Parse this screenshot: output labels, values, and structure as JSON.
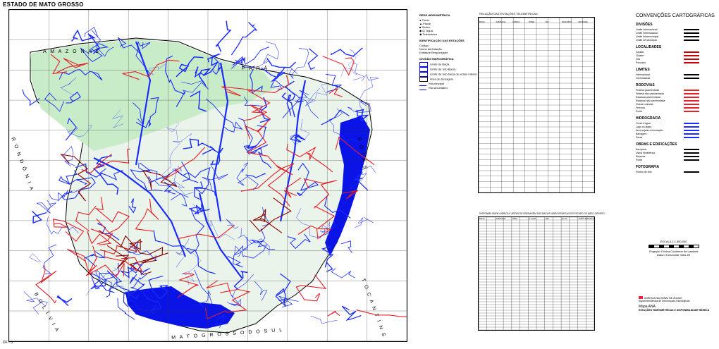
{
  "header": {
    "title": "ESTADO DE MATO GROSSO"
  },
  "sheet": {
    "code": "DF - 3"
  },
  "map": {
    "region_labels": [
      "A M A Z O N A S",
      "P A R Á",
      "M A T O   G R O S S O   D O   S U L",
      "R O N D Ô N I A",
      "B O L Í V I A",
      "G O I Á S",
      "T O C A N T I N S"
    ],
    "colors": {
      "river": "#1a2cff",
      "road": "#e8202a",
      "highway": "#8b0000",
      "swamp": "#0010e0",
      "forest_green": "#c9ecc8",
      "land": "#e9f4ea"
    },
    "longitudes": [
      "60°",
      "59°",
      "58°",
      "57°",
      "56°",
      "55°",
      "54°",
      "53°",
      "52°",
      "51°"
    ],
    "latitudes": [
      "8°",
      "9°",
      "10°",
      "11°",
      "12°",
      "13°",
      "14°",
      "15°",
      "16°",
      "17°",
      "18°"
    ]
  },
  "legend_left": {
    "heading": "REDE HIDROMÉTRICA",
    "items": [
      "Fluvio",
      "Pluvio",
      "Sedim.",
      "Q. Água",
      "Telemétrica"
    ],
    "identification_heading": "IDENTIFICAÇÃO DAS ESTAÇÕES",
    "identification_items": [
      "Código",
      "Nome da Estação",
      "Entidade Responsável"
    ],
    "basin_heading": "DIVISÃO HIDROGRÁFICA",
    "basin_items": [
      "Limite de Bacia",
      "Limite de Sub-Bacia",
      "Limite de Sub-bacia de ordem inferior",
      "Área de drenagem",
      "Rio principal",
      "Rio secundário"
    ]
  },
  "center_table": {
    "title": "RELAÇÃO DAS ESTAÇÕES TELEMÉTRICAS",
    "headers": [
      "BACIA",
      "SUB-BACIA",
      "CÓDIGO",
      "NOME",
      "RIO",
      "MUNICÍPIO",
      "ENTIDADE"
    ],
    "rows": 32
  },
  "bottom_table": {
    "title": "DISPONIBILIDADE HÍDRICA E ÁREAS DE DRENAGEM DAS BACIAS HIDROGRÁFICAS DO ESTADO DE MATO GROSSO",
    "headers": [
      "BACIA",
      "SUB-BACIA",
      "ÁREA",
      "Q média",
      "Q95",
      "Q7,10",
      "VAZÃO ESPECÍFICA"
    ],
    "rows": 40
  },
  "conventions": {
    "title": "CONVENÇÕES  CARTOGRÁFICAS",
    "sections": [
      {
        "name": "DIVISÕES",
        "items": [
          "Limite Internacional",
          "Limite Interestadual",
          "Limite Intermunicipal",
          "Limite de Município"
        ]
      },
      {
        "name": "LOCALIDADES",
        "items": [
          "Capital",
          "Cidade",
          "Vila",
          "Povoado"
        ]
      },
      {
        "name": "LIMITES",
        "items": [
          "Internacional",
          "Interestadual"
        ]
      },
      {
        "name": "RODOVIAS",
        "items": [
          "Federal pavimentada",
          "Federal não pavimentada",
          "Estadual pavimentada",
          "Estadual não pavimentada",
          "Outras rodovias",
          "Ferrovia",
          "Ponte"
        ]
      },
      {
        "name": "HIDROGRAFIA",
        "items": [
          "Curso d'água",
          "Lago ou lagoa",
          "Área sujeita a inundação",
          "Barragem",
          "Canal"
        ]
      },
      {
        "name": "OBRAS E EDIFICAÇÕES",
        "items": [
          "Aeroporto",
          "Usina hidrelétrica",
          "Represa",
          "Ponte"
        ]
      },
      {
        "name": "FOTOGRAFIA",
        "items": [
          "Pontos de foto"
        ]
      }
    ]
  },
  "scale": {
    "text": "ESCALA 1:1.500.000",
    "projection": "Projeção Cônica Conforme de Lambert",
    "datum": "Datum Horizontal: SAD-69"
  },
  "footer": {
    "agency": "AGÊNCIA NACIONAL DE ÁGUAS",
    "subtitle": "Superintendência de Informações Hidrológicas",
    "map_name": "Mapa ANA",
    "sheet_title": "ESTAÇÕES HIDROMÉTRICAS E DISPONIBILIDADE HÍDRICA"
  }
}
